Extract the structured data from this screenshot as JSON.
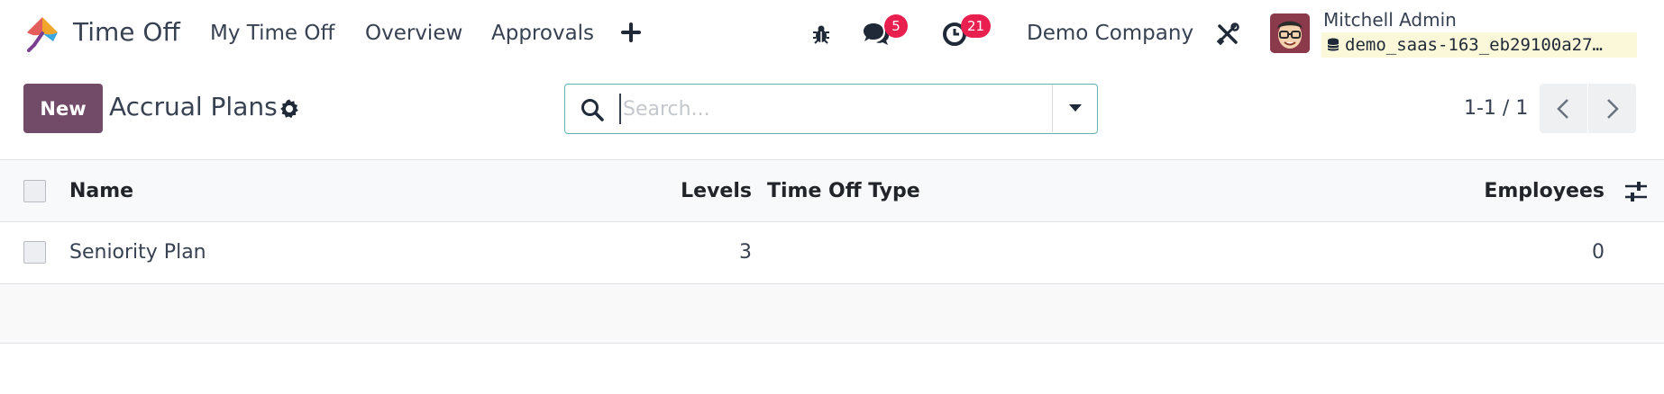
{
  "navbar": {
    "app_name": "Time Off",
    "menu": [
      {
        "label": "My Time Off"
      },
      {
        "label": "Overview"
      },
      {
        "label": "Approvals"
      }
    ],
    "messages_badge": "5",
    "activities_badge": "21",
    "company": "Demo Company",
    "user_name": "Mitchell Admin",
    "database": "demo_saas-163_eb29100a27…"
  },
  "control_panel": {
    "new_label": "New",
    "title": "Accrual Plans",
    "search_placeholder": "Search...",
    "pager": "1-1 / 1"
  },
  "list": {
    "columns": {
      "name": "Name",
      "levels": "Levels",
      "time_off_type": "Time Off Type",
      "employees": "Employees"
    },
    "rows": [
      {
        "name": "Seniority Plan",
        "levels": "3",
        "time_off_type": "",
        "employees": "0"
      }
    ]
  },
  "colors": {
    "brand": "#714b67",
    "badge": "#e9204f",
    "search_border": "#5fb3b3",
    "db_tag_bg": "#fbf7d9"
  },
  "icons": [
    "app-logo-icon",
    "plus-icon",
    "bug-icon",
    "chat-icon",
    "clock-icon",
    "tools-icon",
    "database-icon",
    "gear-icon",
    "search-icon",
    "caret-down-icon",
    "chevron-left-icon",
    "chevron-right-icon",
    "sliders-icon"
  ]
}
